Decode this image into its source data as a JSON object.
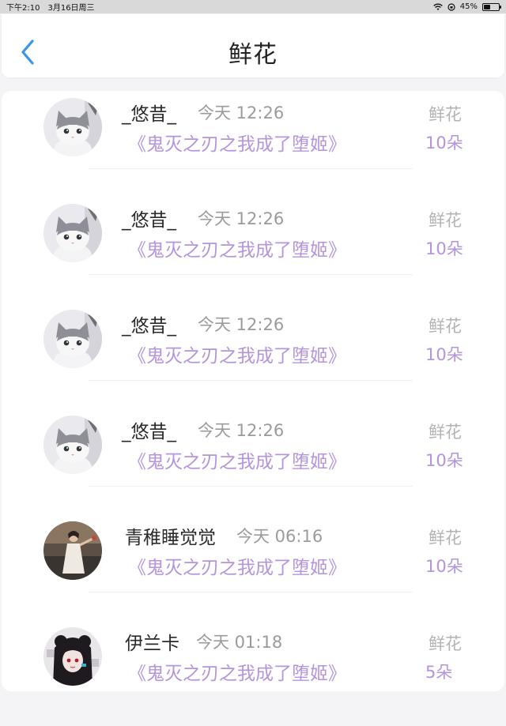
{
  "status_bar": {
    "time": "下午2:10",
    "date": "3月16日周三",
    "battery": "45%",
    "battery_level": 0.45
  },
  "header": {
    "title": "鲜花",
    "back_icon": "chevron-left-icon",
    "accent_color": "#3b95e6"
  },
  "colors": {
    "book": "#b394dd",
    "muted": "#9b9b9b"
  },
  "items": [
    {
      "user": "_悠昔_",
      "time": "今天 12:26",
      "book": "《鬼灭之刃之我成了堕姬》",
      "gift": "鲜花",
      "count": "10朵",
      "avatar": "cat-avatar"
    },
    {
      "user": "_悠昔_",
      "time": "今天 12:26",
      "book": "《鬼灭之刃之我成了堕姬》",
      "gift": "鲜花",
      "count": "10朵",
      "avatar": "cat-avatar"
    },
    {
      "user": "_悠昔_",
      "time": "今天 12:26",
      "book": "《鬼灭之刃之我成了堕姬》",
      "gift": "鲜花",
      "count": "10朵",
      "avatar": "cat-avatar"
    },
    {
      "user": "_悠昔_",
      "time": "今天 12:26",
      "book": "《鬼灭之刃之我成了堕姬》",
      "gift": "鲜花",
      "count": "10朵",
      "avatar": "cat-avatar"
    },
    {
      "user": "青稚睡觉觉",
      "time": "今天 06:16",
      "book": "《鬼灭之刃之我成了堕姬》",
      "gift": "鲜花",
      "count": "10朵",
      "avatar": "photo-avatar"
    },
    {
      "user": "伊兰卡",
      "time": "今天 01:18",
      "book": "《鬼灭之刃之我成了堕姬》",
      "gift": "鲜花",
      "count": "5朵",
      "avatar": "anime-avatar"
    }
  ]
}
